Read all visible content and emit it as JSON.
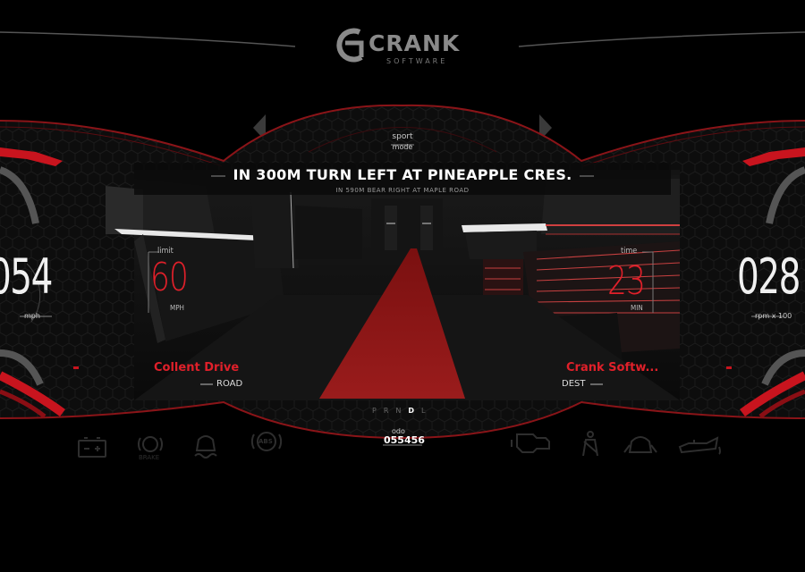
{
  "brand": {
    "name": "CRANK",
    "tagline": "SOFTWARE"
  },
  "mode": {
    "line1": "sport",
    "line2": "mode"
  },
  "navigation": {
    "primary": "IN 300M TURN LEFT AT PINEAPPLE CRES.",
    "secondary": "IN 590M BEAR RIGHT AT MAPLE ROAD"
  },
  "limit": {
    "label": "limit",
    "value": "60",
    "unit": "MPH"
  },
  "time": {
    "label": "time",
    "value": "23",
    "unit": "MIN"
  },
  "speed": {
    "value": "054",
    "unit": "mph"
  },
  "rpm": {
    "value": "028",
    "unit": "rpm x 100"
  },
  "road": {
    "name": "Collent Drive",
    "tag": "ROAD"
  },
  "destination": {
    "name": "Crank Softw...",
    "tag": "DEST"
  },
  "gears": {
    "items": [
      "P",
      "R",
      "N",
      "D",
      "L"
    ],
    "selected": "D"
  },
  "odometer": {
    "label": "odo",
    "value": "055456"
  },
  "telltales": {
    "brake_label": "BRAKE",
    "abs_label": "ABS"
  },
  "colors": {
    "accent": "#e0202a",
    "background": "#000000",
    "panel": "#1a1a1a"
  }
}
